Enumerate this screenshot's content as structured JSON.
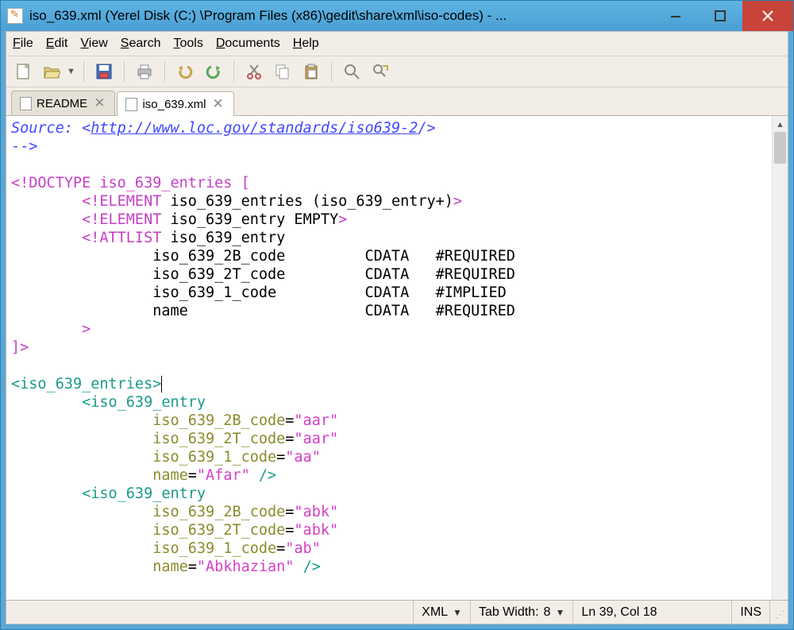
{
  "window": {
    "title": "iso_639.xml (Yerel Disk (C:) \\Program Files (x86)\\gedit\\share\\xml\\iso-codes) - ..."
  },
  "menu": {
    "file": "File",
    "edit": "Edit",
    "view": "View",
    "search": "Search",
    "tools": "Tools",
    "documents": "Documents",
    "help": "Help"
  },
  "tabs": [
    {
      "label": "README",
      "active": false
    },
    {
      "label": "iso_639.xml",
      "active": true
    }
  ],
  "statusbar": {
    "filetype": "XML",
    "tabwidth_label": "Tab Width:",
    "tabwidth_value": "8",
    "position": "Ln 39, Col 18",
    "mode": "INS"
  },
  "code": {
    "l1a": "Source: <",
    "l1b": "http://www.loc.gov/standards/iso639-2",
    "l1c": "/>",
    "l2": "-->",
    "l4a": "<!DOCTYPE iso_639_entries [",
    "l5a": "        <!ELEMENT",
    "l5b": " iso_639_entries (iso_639_entry+)",
    "l5c": ">",
    "l6a": "        <!ELEMENT",
    "l6b": " iso_639_entry EMPTY",
    "l6c": ">",
    "l7a": "        <!ATTLIST",
    "l7b": " iso_639_entry",
    "l8": "                iso_639_2B_code         CDATA   #REQUIRED",
    "l9": "                iso_639_2T_code         CDATA   #REQUIRED",
    "l10": "                iso_639_1_code          CDATA   #IMPLIED",
    "l11": "                name                    CDATA   #REQUIRED",
    "l12a": "        ",
    "l12b": ">",
    "l13": "]>",
    "l15a": "<iso_639_entries>",
    "l16a": "        <iso_639_entry",
    "l17a": "                iso_639_2B_code",
    "l17b": "=",
    "l17c": "\"aar\"",
    "l18a": "                iso_639_2T_code",
    "l18c": "\"aar\"",
    "l19a": "                iso_639_1_code",
    "l19c": "\"aa\"",
    "l20a": "                name",
    "l20c": "\"Afar\"",
    "l20d": " />",
    "l21a": "        <iso_639_entry",
    "l22a": "                iso_639_2B_code",
    "l22c": "\"abk\"",
    "l23a": "                iso_639_2T_code",
    "l23c": "\"abk\"",
    "l24a": "                iso_639_1_code",
    "l24c": "\"ab\"",
    "l25a": "                name",
    "l25c": "\"Abkhazian\"",
    "l25d": " />"
  }
}
